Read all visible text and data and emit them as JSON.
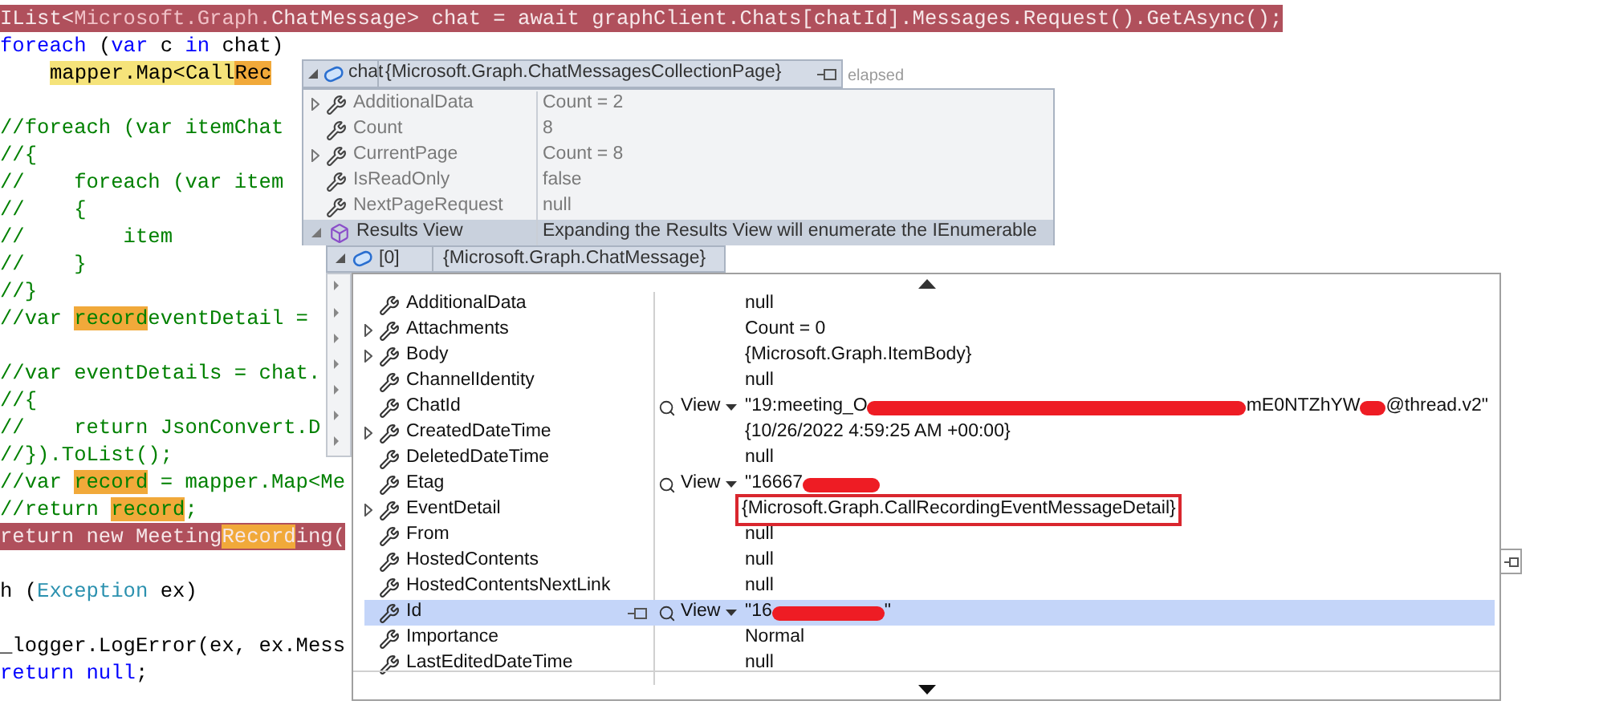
{
  "editor": {
    "hint": "elapsed",
    "blocks": [
      [
        {
          "breakpoint": true,
          "indented": false,
          "segments": [
            {
              "t": "IList<",
              "kind": "light"
            },
            {
              "t": "Microsoft.Graph.",
              "kind": "dim"
            },
            {
              "t": "ChatMessage> chat = await graphClient.Chats[chatId].Messages.Request().GetAsync();",
              "kind": "light"
            }
          ]
        },
        {
          "breakpoint": false,
          "indented": false,
          "segments": [
            {
              "t": "foreach",
              "kind": "keyword"
            },
            {
              "t": " (",
              "kind": "plain"
            },
            {
              "t": "var",
              "kind": "keyword"
            },
            {
              "t": " c ",
              "kind": "plain"
            },
            {
              "t": "in",
              "kind": "keyword"
            },
            {
              "t": " chat)",
              "kind": "plain"
            }
          ]
        },
        {
          "breakpoint": false,
          "indented": true,
          "segments": [
            {
              "t": "mapper.Map<Call",
              "kind": "plain",
              "color": "#f5e37a"
            },
            {
              "t": "Rec",
              "kind": "plain",
              "color": "#f1a93a"
            }
          ]
        }
      ],
      [
        {
          "breakpoint": false,
          "indented": false,
          "segments": [
            {
              "t": "//foreach (var itemChat",
              "kind": "comment"
            }
          ]
        },
        {
          "breakpoint": false,
          "indented": false,
          "segments": [
            {
              "t": "//{",
              "kind": "comment"
            }
          ]
        },
        {
          "breakpoint": false,
          "indented": false,
          "segments": [
            {
              "t": "//    foreach (var item",
              "kind": "comment"
            }
          ]
        },
        {
          "breakpoint": false,
          "indented": false,
          "segments": [
            {
              "t": "//    {",
              "kind": "comment"
            }
          ]
        },
        {
          "breakpoint": false,
          "indented": false,
          "segments": [
            {
              "t": "//        item",
              "kind": "comment"
            }
          ]
        },
        {
          "breakpoint": false,
          "indented": false,
          "segments": [
            {
              "t": "//    }",
              "kind": "comment"
            }
          ]
        },
        {
          "breakpoint": false,
          "indented": false,
          "segments": [
            {
              "t": "//}",
              "kind": "comment"
            }
          ]
        },
        {
          "breakpoint": false,
          "indented": false,
          "segments": [
            {
              "t": "//var ",
              "kind": "comment"
            },
            {
              "t": "record",
              "kind": "comment",
              "color": "#f1a93a"
            },
            {
              "t": "eventDetail =",
              "kind": "comment"
            }
          ]
        }
      ],
      [
        {
          "breakpoint": false,
          "indented": false,
          "segments": [
            {
              "t": "//var eventDetails = chat.",
              "kind": "comment"
            }
          ]
        },
        {
          "breakpoint": false,
          "indented": false,
          "segments": [
            {
              "t": "//{",
              "kind": "comment"
            }
          ]
        },
        {
          "breakpoint": false,
          "indented": false,
          "segments": [
            {
              "t": "//    return JsonConvert.D",
              "kind": "comment"
            }
          ]
        },
        {
          "breakpoint": false,
          "indented": false,
          "segments": [
            {
              "t": "//}).ToList();",
              "kind": "comment"
            }
          ]
        },
        {
          "breakpoint": false,
          "indented": false,
          "segments": [
            {
              "t": "//var ",
              "kind": "comment"
            },
            {
              "t": "record",
              "kind": "comment",
              "color": "#f1a93a"
            },
            {
              "t": " = mapper.Map<Me",
              "kind": "comment"
            }
          ]
        },
        {
          "breakpoint": false,
          "indented": false,
          "segments": [
            {
              "t": "//return ",
              "kind": "comment"
            },
            {
              "t": "record",
              "kind": "comment",
              "color": "#f1a93a"
            },
            {
              "t": ";",
              "kind": "comment"
            }
          ]
        },
        {
          "breakpoint": true,
          "indented": false,
          "segments": [
            {
              "t": "return new Meeting",
              "kind": "light"
            },
            {
              "t": "Record",
              "kind": "light",
              "color": "#f1a93a"
            },
            {
              "t": "ing(",
              "kind": "light"
            }
          ]
        }
      ],
      [
        {
          "breakpoint": false,
          "indented": false,
          "segments": [
            {
              "t": "h (",
              "kind": "plain"
            },
            {
              "t": "Exception",
              "kind": "type"
            },
            {
              "t": " ex)",
              "kind": "plain"
            }
          ]
        }
      ],
      [
        {
          "breakpoint": false,
          "indented": false,
          "segments": [
            {
              "t": "_logger.LogError(ex, ex.Mess",
              "kind": "plain"
            }
          ]
        },
        {
          "breakpoint": false,
          "indented": false,
          "segments": [
            {
              "t": "return null",
              "kind": "keyword"
            },
            {
              "t": ";",
              "kind": "plain"
            }
          ]
        }
      ]
    ]
  },
  "datatip": {
    "name": "chat",
    "value": "{Microsoft.Graph.ChatMessagesCollectionPage}",
    "expanded": true,
    "members": [
      {
        "name": "AdditionalData",
        "value": "Count = 2",
        "expandable": true,
        "expanded": false,
        "kind": "property",
        "selected": false
      },
      {
        "name": "Count",
        "value": "8",
        "expandable": false,
        "expanded": false,
        "kind": "property",
        "selected": false
      },
      {
        "name": "CurrentPage",
        "value": "Count = 8",
        "expandable": true,
        "expanded": false,
        "kind": "property",
        "selected": false
      },
      {
        "name": "IsReadOnly",
        "value": "false",
        "expandable": false,
        "expanded": false,
        "kind": "property",
        "selected": false
      },
      {
        "name": "NextPageRequest",
        "value": "null",
        "expandable": false,
        "expanded": false,
        "kind": "property",
        "selected": false
      },
      {
        "name": "Results View",
        "value": "Expanding the Results View will enumerate the IEnumerable",
        "expandable": true,
        "expanded": true,
        "kind": "results",
        "selected": true
      }
    ]
  },
  "item": {
    "name": "[0]",
    "value": "{Microsoft.Graph.ChatMessage}",
    "expanded": true,
    "members": [
      {
        "name": "AdditionalData",
        "expandable": false,
        "expanded": false,
        "selected": false,
        "boxed": false,
        "value": [
          {
            "kind": "text",
            "t": "null"
          }
        ]
      },
      {
        "name": "Attachments",
        "expandable": true,
        "expanded": false,
        "selected": false,
        "boxed": false,
        "value": [
          {
            "kind": "text",
            "t": "Count = 0"
          }
        ]
      },
      {
        "name": "Body",
        "expandable": true,
        "expanded": false,
        "selected": false,
        "boxed": false,
        "value": [
          {
            "kind": "text",
            "t": "{Microsoft.Graph.ItemBody}"
          }
        ]
      },
      {
        "name": "ChannelIdentity",
        "expandable": false,
        "expanded": false,
        "selected": false,
        "boxed": false,
        "value": [
          {
            "kind": "text",
            "t": "null"
          }
        ]
      },
      {
        "name": "ChatId",
        "expandable": false,
        "expanded": false,
        "view_label": "View",
        "selected": false,
        "boxed": false,
        "value": [
          {
            "kind": "text",
            "t": "\"19:meeting_O"
          },
          {
            "kind": "redacted_long"
          },
          {
            "kind": "text",
            "t": "mE0NTZhYW"
          },
          {
            "kind": "redacted_dot"
          },
          {
            "kind": "text",
            "t": "@thread.v2\""
          }
        ]
      },
      {
        "name": "CreatedDateTime",
        "expandable": true,
        "expanded": false,
        "selected": false,
        "boxed": false,
        "value": [
          {
            "kind": "text",
            "t": "{10/26/2022 4:59:25 AM +00:00}"
          }
        ]
      },
      {
        "name": "DeletedDateTime",
        "expandable": false,
        "expanded": false,
        "selected": false,
        "boxed": false,
        "value": [
          {
            "kind": "text",
            "t": "null"
          }
        ]
      },
      {
        "name": "Etag",
        "expandable": false,
        "expanded": false,
        "view_label": "View",
        "selected": false,
        "boxed": false,
        "value": [
          {
            "kind": "text",
            "t": "\"16667"
          },
          {
            "kind": "redacted_short"
          }
        ]
      },
      {
        "name": "EventDetail",
        "expandable": true,
        "expanded": false,
        "selected": false,
        "boxed": true,
        "value": [
          {
            "kind": "text",
            "t": "{Microsoft.Graph.CallRecordingEventMessageDetail}"
          }
        ]
      },
      {
        "name": "From",
        "expandable": false,
        "expanded": false,
        "selected": false,
        "boxed": false,
        "value": [
          {
            "kind": "text",
            "t": "null"
          }
        ]
      },
      {
        "name": "HostedContents",
        "expandable": false,
        "expanded": false,
        "selected": false,
        "boxed": false,
        "value": [
          {
            "kind": "text",
            "t": "null"
          }
        ]
      },
      {
        "name": "HostedContentsNextLink",
        "expandable": false,
        "expanded": false,
        "selected": false,
        "boxed": false,
        "value": [
          {
            "kind": "text",
            "t": "null"
          }
        ]
      },
      {
        "name": "Id",
        "expandable": false,
        "expanded": false,
        "view_label": "View",
        "selected": true,
        "boxed": false,
        "value": [
          {
            "kind": "text",
            "t": "\"16"
          },
          {
            "kind": "redacted_medium"
          },
          {
            "kind": "text",
            "t": "\""
          }
        ]
      },
      {
        "name": "Importance",
        "expandable": false,
        "expanded": false,
        "selected": false,
        "boxed": false,
        "value": [
          {
            "kind": "text",
            "t": "Normal"
          }
        ]
      },
      {
        "name": "LastEditedDateTime",
        "expandable": false,
        "expanded": false,
        "selected": false,
        "boxed": false,
        "value": [
          {
            "kind": "text",
            "t": "null"
          }
        ]
      }
    ]
  }
}
